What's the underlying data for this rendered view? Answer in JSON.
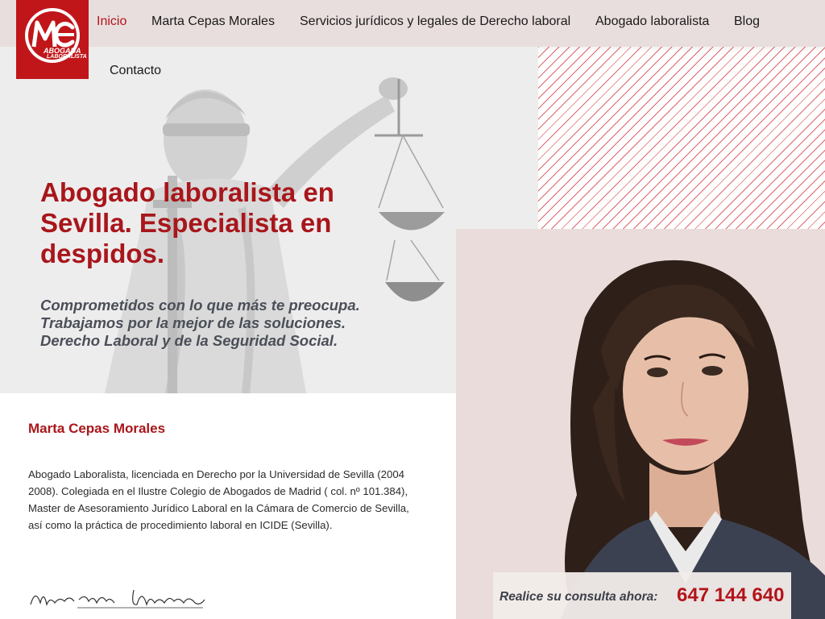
{
  "logo": {
    "monogram": "MC",
    "line1": "ABOGADA",
    "line2": "LABORALISTA"
  },
  "nav": {
    "items": [
      {
        "label": "Inicio",
        "active": true
      },
      {
        "label": "Marta Cepas Morales"
      },
      {
        "label": "Servicios jurídicos y legales de Derecho laboral"
      },
      {
        "label": "Abogado laboralista"
      },
      {
        "label": "Blog"
      },
      {
        "label": "Contacto"
      }
    ]
  },
  "hero": {
    "headline": "Abogado laboralista en Sevilla. Especialista en despidos.",
    "subline": [
      "Comprometidos con lo que más te preocupa.",
      "Trabajamos por la mejor de las soluciones.",
      "Derecho Laboral y de la Seguridad Social."
    ]
  },
  "bio": {
    "name": "Marta Cepas Morales",
    "text": "Abogado Laboralista, licenciada en Derecho por la Universidad de Sevilla (2004 2008). Colegiada en el Ilustre Colegio de Abogados de Madrid ( col. nº 101.384), Master de Asesoramiento Jurídico Laboral en la Cámara de Comercio de Sevilla, así como la práctica de procedimiento laboral en ICIDE (Sevilla).",
    "signature": "Marta Cepas Morales"
  },
  "cta": {
    "label": "Realice su consulta ahora:",
    "phone": "647 144 640"
  },
  "colors": {
    "accent": "#b3141a",
    "logo_bg": "#c0161a",
    "header_bg": "#e8dedd",
    "photo_bg": "#e9dcda"
  },
  "icons": {
    "logo": "mc-logo",
    "statue": "lady-justice-image",
    "portrait": "lawyer-portrait-image",
    "signature": "handwritten-signature"
  }
}
